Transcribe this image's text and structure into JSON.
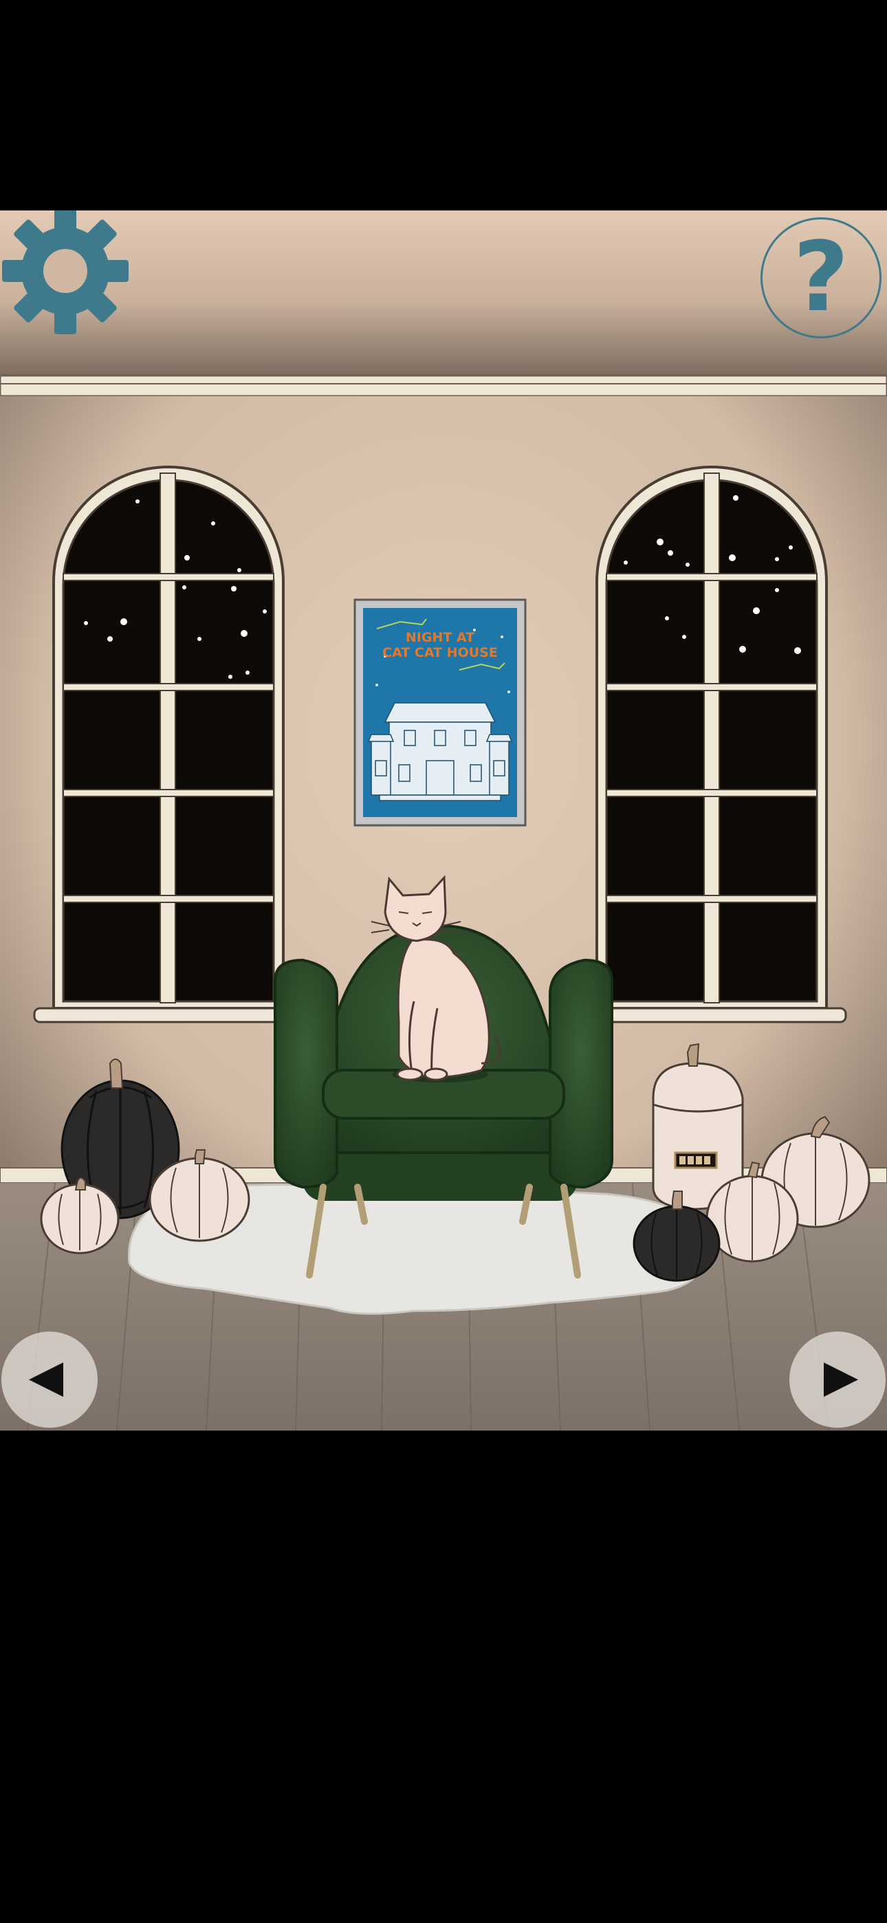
{
  "game": {
    "title": "Night at Cat Cat House",
    "room": "living-room-with-green-armchair"
  },
  "hud": {
    "settings_icon": "gear-icon",
    "help_label": "?",
    "nav_left_icon": "arrow-left-icon",
    "nav_right_icon": "arrow-right-icon"
  },
  "poster": {
    "line1": "NIGHT AT",
    "line2": "CAT CAT HOUSE"
  },
  "colors": {
    "accent_teal": "#3f7a8c",
    "wall": "#dcc6b0",
    "floor": "#8a7d70",
    "chair_green": "#2e4d2b",
    "poster_blue": "#1e77a8",
    "poster_text": "#e07a2e"
  }
}
